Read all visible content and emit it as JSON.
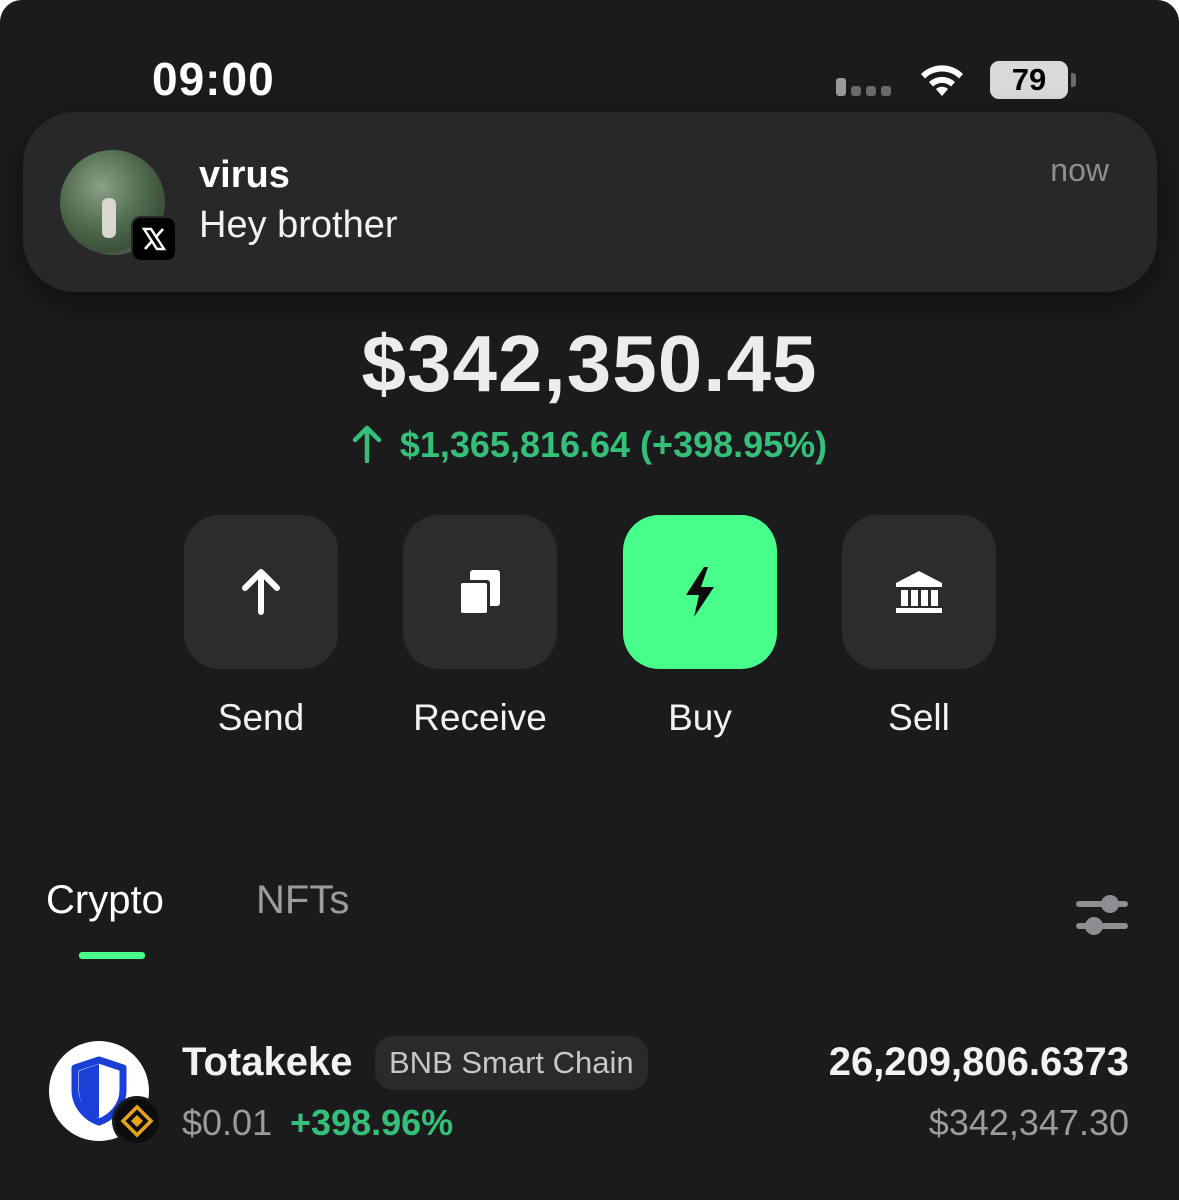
{
  "status_bar": {
    "time": "09:00",
    "battery": "79",
    "icons": [
      "cellular-signal-icon",
      "wifi-icon",
      "battery-icon"
    ]
  },
  "notification": {
    "app_icon": "x-logo-icon",
    "sender": "virus",
    "message": "Hey brother",
    "time": "now"
  },
  "wallet": {
    "balance": "$342,350.45",
    "change_icon": "arrow-up-icon",
    "change": "$1,365,816.64 (+398.95%)"
  },
  "actions": [
    {
      "label": "Send",
      "icon": "arrow-up-icon"
    },
    {
      "label": "Receive",
      "icon": "copy-icon"
    },
    {
      "label": "Buy",
      "icon": "lightning-icon"
    },
    {
      "label": "Sell",
      "icon": "bank-icon"
    }
  ],
  "tabs": {
    "active": "Crypto",
    "items": [
      "Crypto",
      "NFTs"
    ],
    "filter_icon": "sliders-icon"
  },
  "assets": [
    {
      "name": "Totakeke",
      "chain": "BNB Smart Chain",
      "price": "$0.01",
      "change": "+398.96%",
      "quantity": "26,209,806.6373",
      "value": "$342,347.30",
      "logo_icon": "shield-icon",
      "chain_icon": "bnb-chain-icon"
    }
  ],
  "colors": {
    "background": "#1b1b1d",
    "accent": "#47ff8a",
    "positive": "#35c07a",
    "card": "#2c2c2e"
  }
}
